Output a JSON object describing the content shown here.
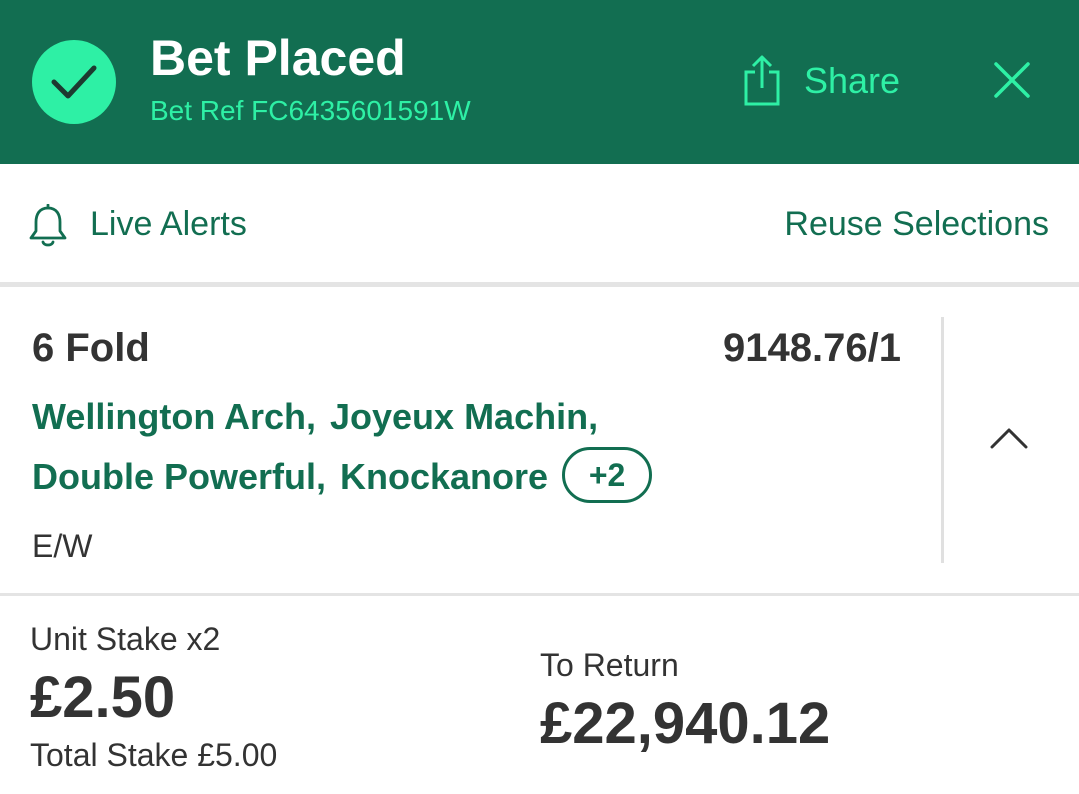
{
  "header": {
    "title": "Bet Placed",
    "bet_ref": "Bet Ref FC6435601591W",
    "share_label": "Share",
    "icons": {
      "status": "check-icon",
      "share": "share-icon",
      "close": "close-icon"
    }
  },
  "actions": {
    "live_alerts_label": "Live Alerts",
    "reuse_label": "Reuse Selections",
    "icons": {
      "alerts": "bell-icon"
    }
  },
  "bet": {
    "type": "6 Fold",
    "odds": "9148.76/1",
    "selections": [
      "Wellington Arch,",
      "Joyeux Machin,",
      "Double Powerful,",
      "Knockanore"
    ],
    "more_count": "+2",
    "each_way": "E/W",
    "icons": {
      "toggle": "chevron-up-icon"
    }
  },
  "stake": {
    "unit_label": "Unit Stake x2",
    "unit_value": "£2.50",
    "total_label": "Total Stake £5.00",
    "return_label": "To Return",
    "return_value": "£22,940.12"
  },
  "colors": {
    "header_bg": "#126e51",
    "accent": "#2ef0a5",
    "text_green": "#126e51",
    "text_dark": "#333333"
  }
}
